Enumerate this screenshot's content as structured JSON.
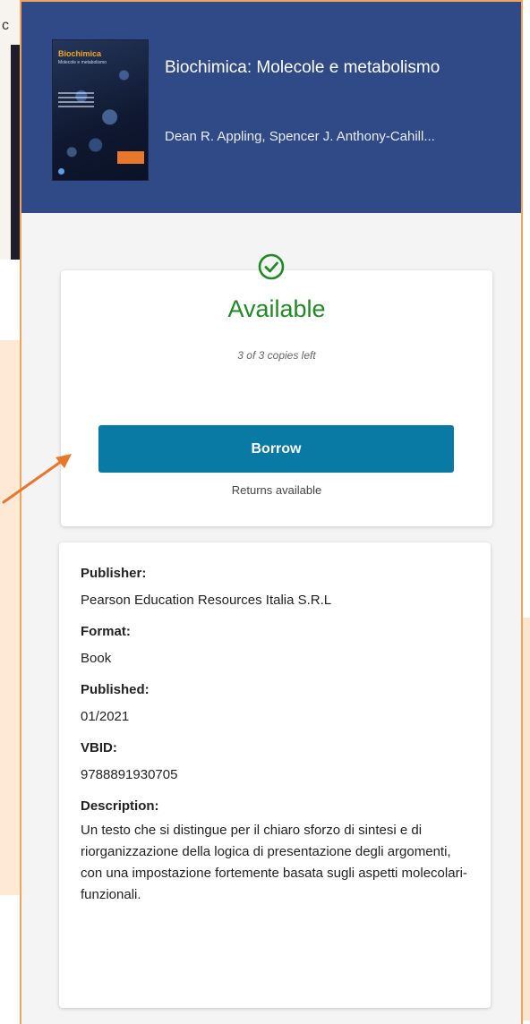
{
  "side": {
    "strip_text": "c"
  },
  "book": {
    "title": "Biochimica: Molecole e metabolismo",
    "authors": "Dean R. Appling, Spencer J. Anthony-Cahill...",
    "cover_title": "Biochimica",
    "cover_subtitle": "Molecole e metabolismo"
  },
  "availability": {
    "status": "Available",
    "copies": "3 of 3 copies left",
    "borrow_label": "Borrow",
    "returns": "Returns available",
    "status_color": "#1f8a24",
    "button_color": "#087aa3"
  },
  "details": {
    "publisher_label": "Publisher:",
    "publisher": "Pearson Education Resources Italia S.R.L",
    "format_label": "Format:",
    "format": "Book",
    "published_label": "Published:",
    "published": "01/2021",
    "vbid_label": "VBID:",
    "vbid": "9788891930705",
    "description_label": "Description:",
    "description": "Un testo che si distingue per il chiaro sforzo di sintesi e di riorganizzazione della logica di presentazione degli argomenti, con una impostazione fortemente basata sugli aspetti molecolari-funzionali."
  },
  "colors": {
    "header": "#2f4a87",
    "panel_border": "#f0a55a",
    "arrow": "#e8762b"
  }
}
